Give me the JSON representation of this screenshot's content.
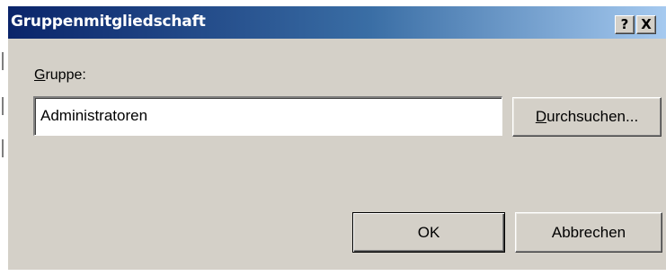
{
  "window": {
    "title": "Gruppenmitgliedschaft",
    "help_button": "?",
    "close_button": "X"
  },
  "form": {
    "group_label_accel": "G",
    "group_label_rest": "ruppe:",
    "group_value": "Administratoren",
    "browse_accel": "D",
    "browse_rest": "urchsuchen..."
  },
  "buttons": {
    "ok": "OK",
    "cancel": "Abbrechen"
  },
  "colors": {
    "titlebar_start": "#0a246a",
    "titlebar_end": "#a6caf0",
    "dialog_face": "#d4d0c8"
  }
}
